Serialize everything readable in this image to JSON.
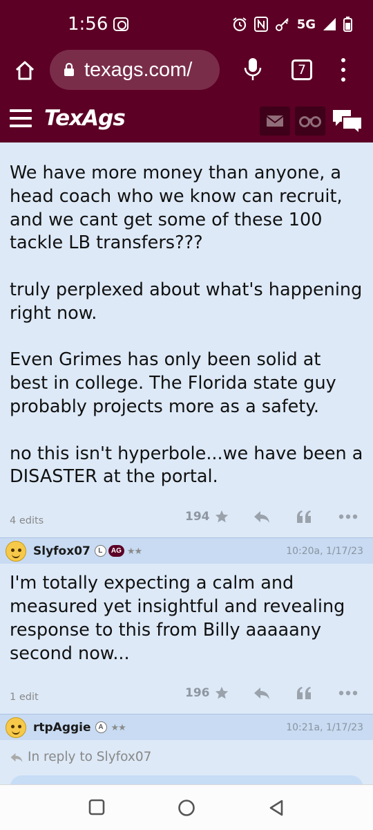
{
  "status": {
    "time": "1:56",
    "network": "5G",
    "icons": [
      "screen-record-icon",
      "alarm-icon",
      "nfc-icon",
      "key-icon",
      "signal-icon",
      "battery-icon"
    ]
  },
  "browser": {
    "url": "texags.com/",
    "tab_count": "7",
    "icons": [
      "home-icon",
      "lock-icon",
      "mic-icon",
      "tabs-icon",
      "more-icon"
    ]
  },
  "site": {
    "logo": "TexAgs",
    "brand_color": "#5c0025",
    "icons": [
      "hamburger-icon",
      "mail-icon",
      "binoculars-icon",
      "chat-icon"
    ]
  },
  "posts": [
    {
      "paragraphs": [
        "We have more money than anyone, a head coach who we know can recruit, and we cant get some of these 100 tackle LB transfers???",
        "truly perplexed about what's happening right now.",
        "Even Grimes has only been solid at best in college. The Florida state guy probably projects more as a safety.",
        "no this isn't hyperbole...we have been a DISASTER at the portal."
      ],
      "edits": "4 edits",
      "likes": "194"
    },
    {
      "username": "Slyfox07",
      "badge_l": "L",
      "badge_ag": "AG",
      "stars": "★★",
      "timestamp": "10:20a, 1/17/23",
      "text": "I'm totally expecting a calm and measured yet insightful and revealing response to this from Billy aaaaany second now...",
      "edits": "1 edit",
      "likes": "196"
    },
    {
      "username": "rtpAggie",
      "badge_a": "A",
      "stars": "★★",
      "timestamp": "10:21a, 1/17/23",
      "reply_to": "In reply to Slyfox07"
    }
  ],
  "nav": {
    "icons": [
      "recents-icon",
      "home-circle-icon",
      "back-icon"
    ]
  }
}
